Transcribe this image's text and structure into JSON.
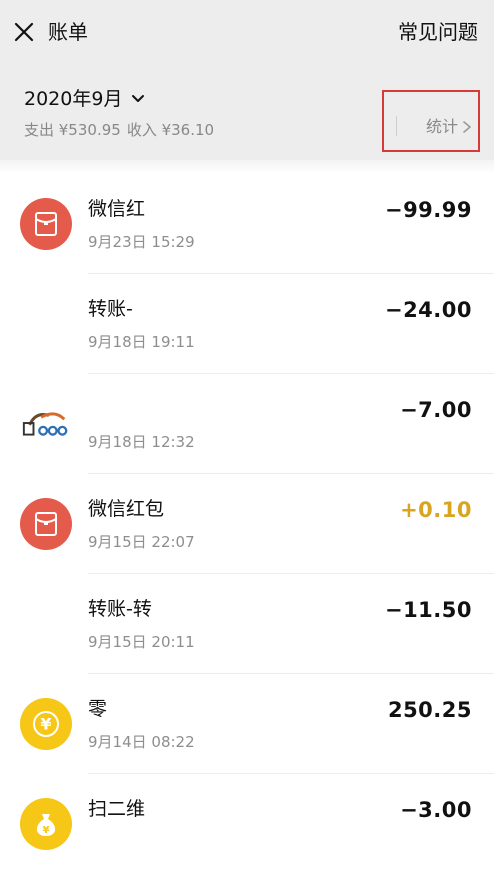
{
  "header": {
    "close_icon": "close-icon",
    "title": "账单",
    "faq_label": "常见问题"
  },
  "summary": {
    "month": "2020年9月",
    "expense_text": "支出 ¥530.95",
    "income_text": "收入 ¥36.10",
    "stats_label": "统计"
  },
  "colors": {
    "red_packet": "#e45b4b",
    "income_amount": "#d9a520",
    "highlight_box": "#d83a3a",
    "coin": "#f6c716"
  },
  "transactions": [
    {
      "name": "微信红",
      "date": "9月23日 15:29",
      "amount": "−99.99",
      "icon": "red-packet-icon"
    },
    {
      "name": "转账-",
      "date": "9月18日 19:11",
      "amount": "−24.00",
      "icon": "none"
    },
    {
      "name": "",
      "date": "9月18日 12:32",
      "amount": "−7.00",
      "icon": "merchant-logo-icon"
    },
    {
      "name": "微信红包",
      "date": "9月15日 22:07",
      "amount": "+0.10",
      "icon": "red-packet-icon"
    },
    {
      "name": "转账-转",
      "date": "9月15日 20:11",
      "amount": "−11.50",
      "icon": "none"
    },
    {
      "name": "零",
      "date": "9月14日 08:22",
      "amount": "250.25",
      "icon": "yuan-coin-icon"
    },
    {
      "name": "扫二维",
      "date": "",
      "amount": "−3.00",
      "icon": "money-bag-icon"
    }
  ]
}
